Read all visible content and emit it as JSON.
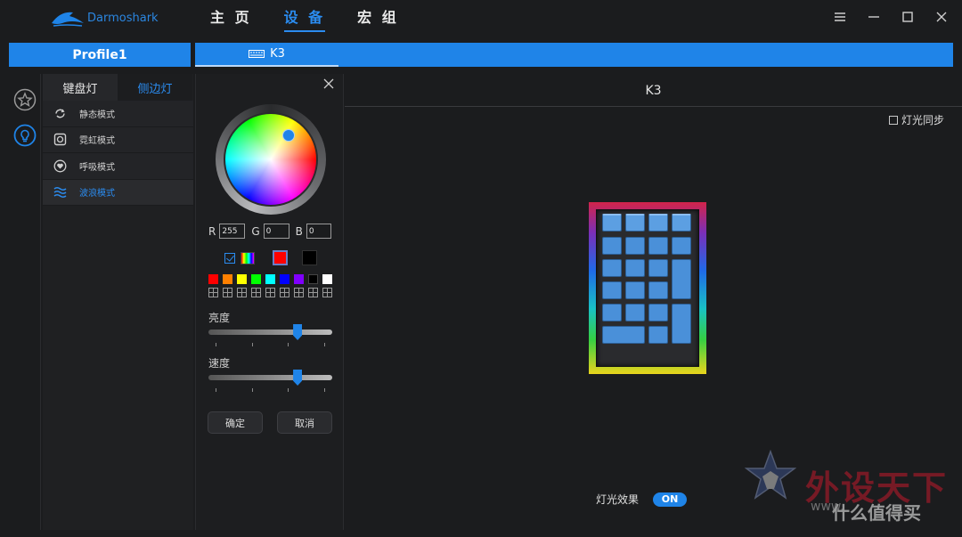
{
  "app": {
    "brand": "Darmoshark",
    "nav": [
      {
        "label": "主 页",
        "active": false
      },
      {
        "label": "设 备",
        "active": true
      },
      {
        "label": "宏 组",
        "active": false
      }
    ],
    "window_controls": [
      "menu-icon",
      "minimize-icon",
      "maximize-icon",
      "close-icon"
    ]
  },
  "profile": {
    "label": "Profile1"
  },
  "device_tab": {
    "label": "K3",
    "icon": "keyboard-icon"
  },
  "rail": {
    "icons": [
      "star-icon",
      "bulb-icon"
    ]
  },
  "mode_panel": {
    "tabs": [
      {
        "label": "键盘灯",
        "active": true
      },
      {
        "label": "侧边灯",
        "active": false
      }
    ],
    "modes": [
      {
        "label": "静态模式",
        "icon": "refresh-icon",
        "active": false
      },
      {
        "label": "霓虹模式",
        "icon": "square-ring-icon",
        "active": false
      },
      {
        "label": "呼吸模式",
        "icon": "heart-icon",
        "active": false
      },
      {
        "label": "波浪模式",
        "icon": "wave-icon",
        "active": true
      }
    ]
  },
  "color_picker": {
    "rgb": {
      "r_label": "R",
      "r": "255",
      "g_label": "G",
      "g": "0",
      "b_label": "B",
      "b": "0"
    },
    "current_colors": {
      "rainbow_checked": true,
      "primary": "#ff0000",
      "secondary": "#000000"
    },
    "presets": [
      "#ff0000",
      "#ff8000",
      "#ffff00",
      "#00ff00",
      "#00ffff",
      "#0000ff",
      "#8000ff",
      "#000000",
      "#ffffff"
    ],
    "brightness": {
      "label": "亮度",
      "value_fraction": 0.72
    },
    "speed": {
      "label": "速度",
      "value_fraction": 0.72
    },
    "confirm_label": "确定",
    "cancel_label": "取消"
  },
  "main": {
    "device_title": "K3",
    "sync": {
      "label": "灯光同步",
      "checked": false
    },
    "light_effect": {
      "label": "灯光效果",
      "toggle": "ON"
    }
  },
  "watermark": {
    "title": "外设天下",
    "url": "www.",
    "tag": "什么值得买"
  },
  "colors": {
    "accent": "#1f84e8",
    "background": "#1b1c1e",
    "key_blue": "#4a90d9"
  }
}
